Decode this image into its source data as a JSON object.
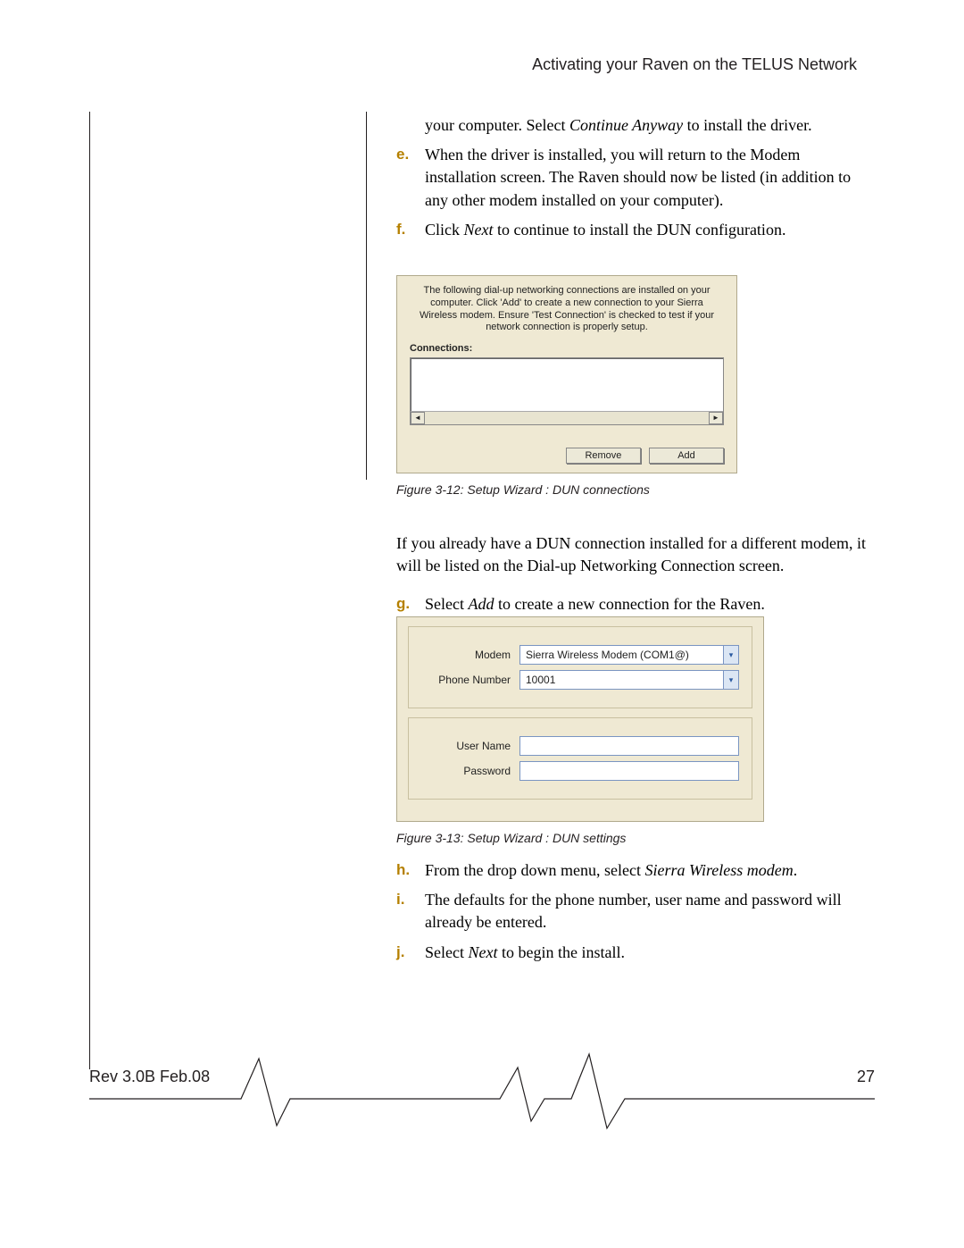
{
  "header": {
    "title": "Activating your Raven on the TELUS Network"
  },
  "body": {
    "intro_frag": "your computer. Select ",
    "intro_em": "Continue Anyway",
    "intro_tail": " to install the driver.",
    "steps1": {
      "e": {
        "mark": "e.",
        "text": "When the driver is installed, you will return to the Modem installation screen. The Raven should now be listed (in addition to any other modem installed on your computer)."
      },
      "f": {
        "mark": "f.",
        "pre": "Click ",
        "em": "Next",
        "post": " to continue to install the DUN configuration."
      }
    },
    "fig12": {
      "desc": "The following dial-up networking connections are installed on your computer. Click 'Add' to create a new connection to your Sierra Wireless modem. Ensure 'Test Connection' is checked to test if your network connection is properly setup.",
      "connections_label": "Connections:",
      "remove": "Remove",
      "add": "Add",
      "caption": "Figure 3-12: Setup Wizard : DUN connections"
    },
    "mid_para": "If you already have a DUN connection installed for a different modem, it will be listed on the Dial-up Networking Connection screen.",
    "g": {
      "mark": "g.",
      "pre": "Select ",
      "em": "Add",
      "post": " to create a new connection for the Raven."
    },
    "fig13": {
      "modem_label": "Modem",
      "modem_value": "Sierra Wireless Modem (COM1@)",
      "phone_label": "Phone Number",
      "phone_value": "10001",
      "user_label": "User Name",
      "user_value": "",
      "pass_label": "Password",
      "pass_value": "",
      "caption": "Figure 3-13: Setup Wizard : DUN settings"
    },
    "steps2": {
      "h": {
        "mark": "h.",
        "pre": "From the drop down menu, select ",
        "em": "Sierra Wireless modem",
        "post": "."
      },
      "i": {
        "mark": "i.",
        "text": "The defaults for the phone number, user name and password will already be entered."
      },
      "j": {
        "mark": "j.",
        "pre": "Select ",
        "em": "Next",
        "post": " to begin the install."
      }
    }
  },
  "footer": {
    "rev": "Rev 3.0B  Feb.08",
    "page": "27"
  }
}
